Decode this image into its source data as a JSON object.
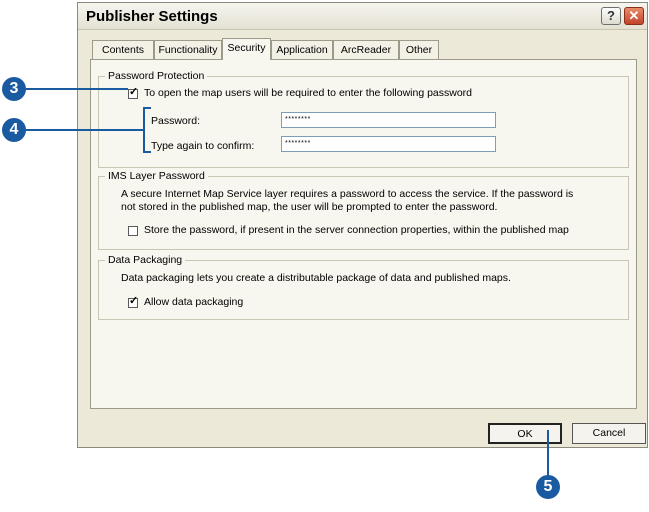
{
  "window": {
    "title": "Publisher Settings",
    "help_glyph": "?",
    "close_glyph": "✕"
  },
  "tabs": [
    "Contents",
    "Functionality",
    "Security",
    "Application",
    "ArcReader",
    "Other"
  ],
  "active_tab": "Security",
  "password_protection": {
    "title": "Password Protection",
    "checkbox_label": "To open the map users will be required to enter the following password",
    "checked": true,
    "password_label": "Password:",
    "password_value": "********",
    "confirm_label": "Type again to confirm:",
    "confirm_value": "********"
  },
  "ims": {
    "title": "IMS Layer Password",
    "description_line1": "A secure Internet Map Service layer requires a password to access the service.  If the password is",
    "description_line2": "not stored in the published map, the user will be prompted to enter the password.",
    "checkbox_label": "Store the password, if present in the server connection properties, within the published map",
    "checked": false
  },
  "packaging": {
    "title": "Data Packaging",
    "description": "Data packaging lets you create a distributable package of data and published maps.",
    "checkbox_label": "Allow data packaging",
    "checked": true
  },
  "buttons": {
    "ok": "OK",
    "cancel": "Cancel"
  },
  "callouts": {
    "c3": "3",
    "c4": "4",
    "c5": "5"
  },
  "checkmark": "✓",
  "colors": {
    "callout": "#1a5aa0",
    "dialog_bg": "#ece9d8"
  }
}
